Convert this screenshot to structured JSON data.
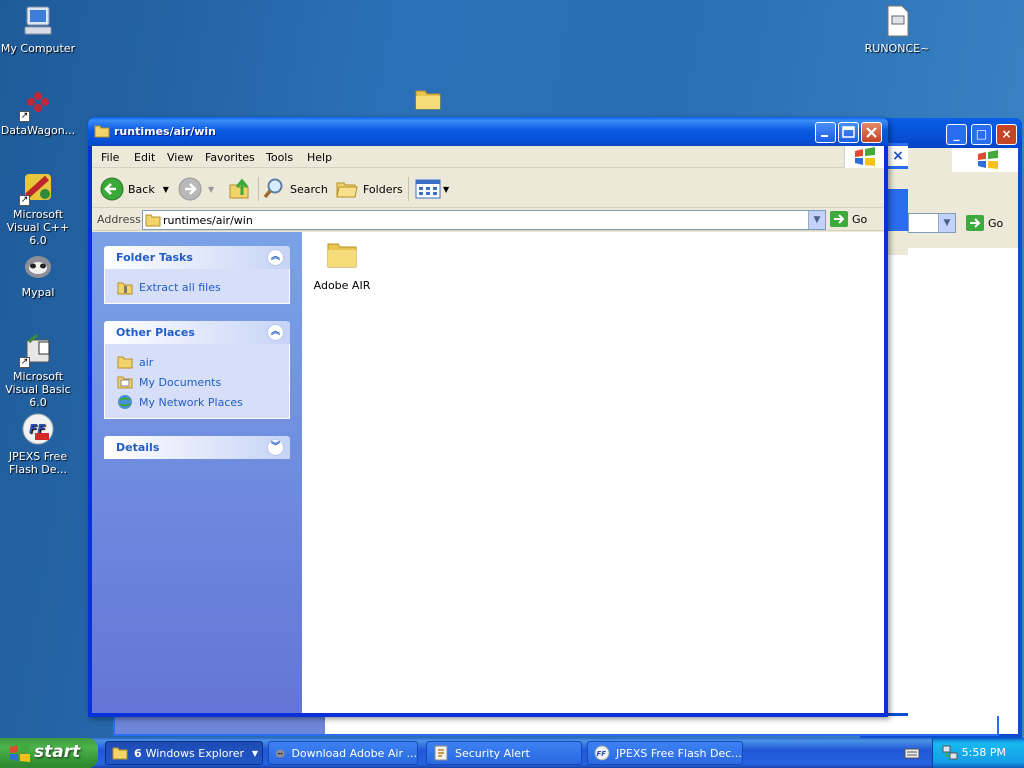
{
  "desktop": {
    "icons": [
      {
        "label": "My Computer",
        "icon": "my-computer-icon"
      },
      {
        "label": "DataWagon...",
        "icon": "datawagon-icon"
      },
      {
        "label": "Microsoft Visual C++ 6.0",
        "icon": "visual-cpp-icon"
      },
      {
        "label": "Mypal",
        "icon": "mypal-icon"
      },
      {
        "label": "Microsoft Visual Basic 6.0",
        "icon": "visual-basic-icon"
      },
      {
        "label": "JPEXS Free Flash De...",
        "icon": "jpexs-icon"
      },
      {
        "label": "RUNONCE~",
        "icon": "document-icon"
      }
    ]
  },
  "window": {
    "title": "runtimes/air/win",
    "menu": [
      "File",
      "Edit",
      "View",
      "Favorites",
      "Tools",
      "Help"
    ],
    "toolbar": {
      "back": "Back",
      "search": "Search",
      "folders": "Folders"
    },
    "address": {
      "label": "Address",
      "value": "runtimes/air/win",
      "go": "Go"
    },
    "task_pane": {
      "folder_tasks": {
        "title": "Folder Tasks",
        "links": [
          "Extract all files"
        ]
      },
      "other_places": {
        "title": "Other Places",
        "links": [
          "air",
          "My Documents",
          "My Network Places"
        ]
      },
      "details": {
        "title": "Details"
      }
    },
    "files": [
      {
        "name": "Adobe AIR",
        "icon": "folder-icon"
      }
    ]
  },
  "background_window": {
    "go": "Go"
  },
  "taskbar": {
    "start": "start",
    "tasks": [
      {
        "count": "6",
        "label": "Windows Explorer",
        "active": true
      },
      {
        "label": "Download Adobe Air ...",
        "active": false
      },
      {
        "label": "Security Alert",
        "active": false
      },
      {
        "label": "JPEXS Free Flash Dec...",
        "active": false
      }
    ],
    "clock": "5:58 PM"
  },
  "colors": {
    "desktop": "#2b70b6",
    "titlebar": "#0a5be6",
    "taskpane": "#6d86d7",
    "link": "#215dc6",
    "start": "#3c9a3c"
  }
}
